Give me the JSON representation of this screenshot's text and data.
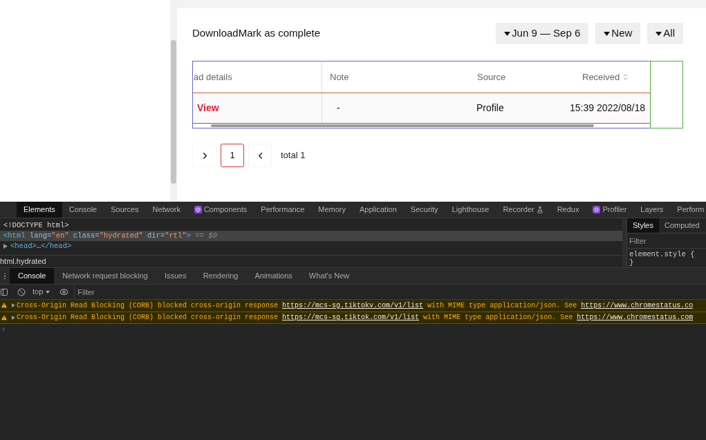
{
  "page": {
    "title": "DownloadMark as complete",
    "filters": [
      {
        "label": "Jun 9 — Sep 6"
      },
      {
        "label": "New"
      },
      {
        "label": "All"
      }
    ],
    "table": {
      "columns": [
        {
          "label": "ad details",
          "sortable": false
        },
        {
          "label": "Note",
          "sortable": false
        },
        {
          "label": "Source",
          "sortable": false
        },
        {
          "label": "Received",
          "sortable": true
        }
      ],
      "rows": [
        {
          "cells": [
            {
              "kind": "link",
              "text": "View"
            },
            {
              "kind": "text",
              "text": "-"
            },
            {
              "kind": "text",
              "text": "Profile"
            },
            {
              "kind": "text",
              "text": "15:39 2022/08/18"
            }
          ]
        }
      ]
    },
    "pagination": {
      "pages": [
        {
          "label": "1",
          "selected": true
        }
      ],
      "total": "total 1"
    }
  },
  "devtools": {
    "tabs": [
      {
        "label": "Elements",
        "selected": true,
        "kind": "plain"
      },
      {
        "label": "Console",
        "selected": false,
        "kind": "plain"
      },
      {
        "label": "Sources",
        "selected": false,
        "kind": "plain"
      },
      {
        "label": "Network",
        "selected": false,
        "kind": "plain"
      },
      {
        "label": "Components",
        "selected": false,
        "kind": "react"
      },
      {
        "label": "Performance",
        "selected": false,
        "kind": "plain"
      },
      {
        "label": "Memory",
        "selected": false,
        "kind": "plain"
      },
      {
        "label": "Application",
        "selected": false,
        "kind": "plain"
      },
      {
        "label": "Security",
        "selected": false,
        "kind": "plain"
      },
      {
        "label": "Lighthouse",
        "selected": false,
        "kind": "plain"
      },
      {
        "label": "Recorder",
        "selected": false,
        "kind": "experiment"
      },
      {
        "label": "Redux",
        "selected": false,
        "kind": "plain"
      },
      {
        "label": "Profiler",
        "selected": false,
        "kind": "react"
      },
      {
        "label": "Layers",
        "selected": false,
        "kind": "plain"
      },
      {
        "label": "Perform",
        "selected": false,
        "kind": "plain"
      }
    ],
    "dom_lines": [
      {
        "selected": false,
        "tokens": [
          {
            "kind": "plain",
            "text": "<!DOCTYPE html>"
          }
        ]
      },
      {
        "selected": true,
        "tokens": [
          {
            "kind": "tag",
            "text": "<html"
          },
          {
            "kind": "attr",
            "text": " lang="
          },
          {
            "kind": "value",
            "text": "\"en\""
          },
          {
            "kind": "attr",
            "text": " class="
          },
          {
            "kind": "value",
            "text": "\"hydrated\""
          },
          {
            "kind": "attr",
            "text": " dir="
          },
          {
            "kind": "value",
            "text": "\"rtl\""
          },
          {
            "kind": "tag",
            "text": ">"
          },
          {
            "kind": "ref",
            "text": " == $0"
          }
        ]
      },
      {
        "selected": false,
        "expanded": false,
        "tokens": [
          {
            "kind": "tag",
            "text": "<head>"
          },
          {
            "kind": "plain",
            "text": "…"
          },
          {
            "kind": "tag",
            "text": "</head>"
          }
        ]
      }
    ],
    "breadcrumb": "html.hydrated",
    "styles": {
      "tabs": [
        {
          "label": "Styles",
          "selected": true
        },
        {
          "label": "Computed",
          "selected": false
        }
      ],
      "filter_placeholder": "Filter",
      "rule_open": "element.style {",
      "rule_close": "}"
    },
    "drawer_tabs": [
      {
        "label": "Console",
        "selected": true
      },
      {
        "label": "Network request blocking",
        "selected": false
      },
      {
        "label": "Issues",
        "selected": false
      },
      {
        "label": "Rendering",
        "selected": false
      },
      {
        "label": "Animations",
        "selected": false
      },
      {
        "label": "What's New",
        "selected": false
      }
    ],
    "console": {
      "context": "top",
      "filter_placeholder": "Filter",
      "messages": [
        {
          "kind": "warning",
          "parts": [
            {
              "kind": "text",
              "text": "Cross-Origin Read Blocking (CORB) blocked cross-origin response "
            },
            {
              "kind": "link",
              "text": "https://mcs-sg.tiktokv.com/v1/list"
            },
            {
              "kind": "text",
              "text": " with MIME type application/json. See "
            },
            {
              "kind": "link",
              "text": "https://www.chromestatus.co"
            }
          ]
        },
        {
          "kind": "warning",
          "parts": [
            {
              "kind": "text",
              "text": "Cross-Origin Read Blocking (CORB) blocked cross-origin response "
            },
            {
              "kind": "link",
              "text": "https://mcs-sg.tiktok.com/v1/list"
            },
            {
              "kind": "text",
              "text": " with MIME type application/json. See "
            },
            {
              "kind": "link",
              "text": "https://www.chromestatus.com"
            }
          ]
        }
      ]
    }
  }
}
